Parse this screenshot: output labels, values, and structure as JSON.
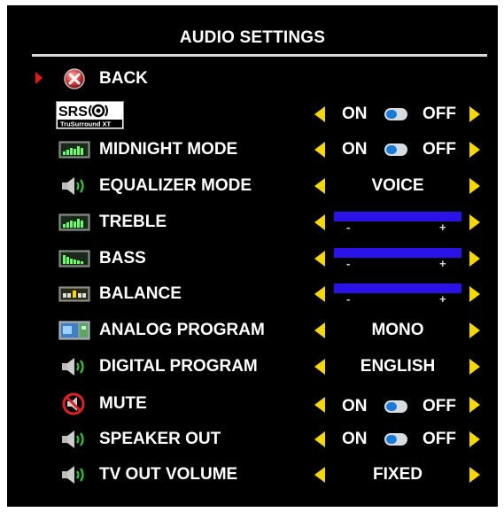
{
  "title": "AUDIO SETTINGS",
  "colors": {
    "background": "#000000",
    "text": "#ffffff",
    "arrow": "#f5d800",
    "slider": "#2a12e8",
    "selection": "#e81818"
  },
  "back": {
    "label": "BACK",
    "icon": "close-icon"
  },
  "srs": {
    "logo_text": "SRS",
    "logo_subtext": "TruSurround XT",
    "on": "ON",
    "off": "OFF"
  },
  "midnight": {
    "label": "MIDNIGHT MODE",
    "icon": "equalizer-display-icon",
    "on": "ON",
    "off": "OFF"
  },
  "equalizer": {
    "label": "EQUALIZER MODE",
    "icon": "speaker-icon",
    "value": "VOICE"
  },
  "treble": {
    "label": "TREBLE",
    "icon": "equalizer-display-icon",
    "minus": "-",
    "plus": "+"
  },
  "bass": {
    "label": "BASS",
    "icon": "equalizer-display-icon",
    "minus": "-",
    "plus": "+"
  },
  "balance": {
    "label": "BALANCE",
    "icon": "balance-display-icon",
    "minus": "-",
    "plus": "+"
  },
  "analog": {
    "label": "ANALOG PROGRAM",
    "icon": "tv-screen-icon",
    "value": "MONO"
  },
  "digital": {
    "label": "DIGITAL PROGRAM",
    "icon": "speaker-icon",
    "value": "ENGLISH"
  },
  "mute": {
    "label": "MUTE",
    "icon": "mute-icon",
    "on": "ON",
    "off": "OFF"
  },
  "speaker_out": {
    "label": "SPEAKER OUT",
    "icon": "speaker-icon",
    "on": "ON",
    "off": "OFF"
  },
  "tv_out": {
    "label": "TV OUT VOLUME",
    "icon": "speaker-icon",
    "value": "FIXED"
  }
}
